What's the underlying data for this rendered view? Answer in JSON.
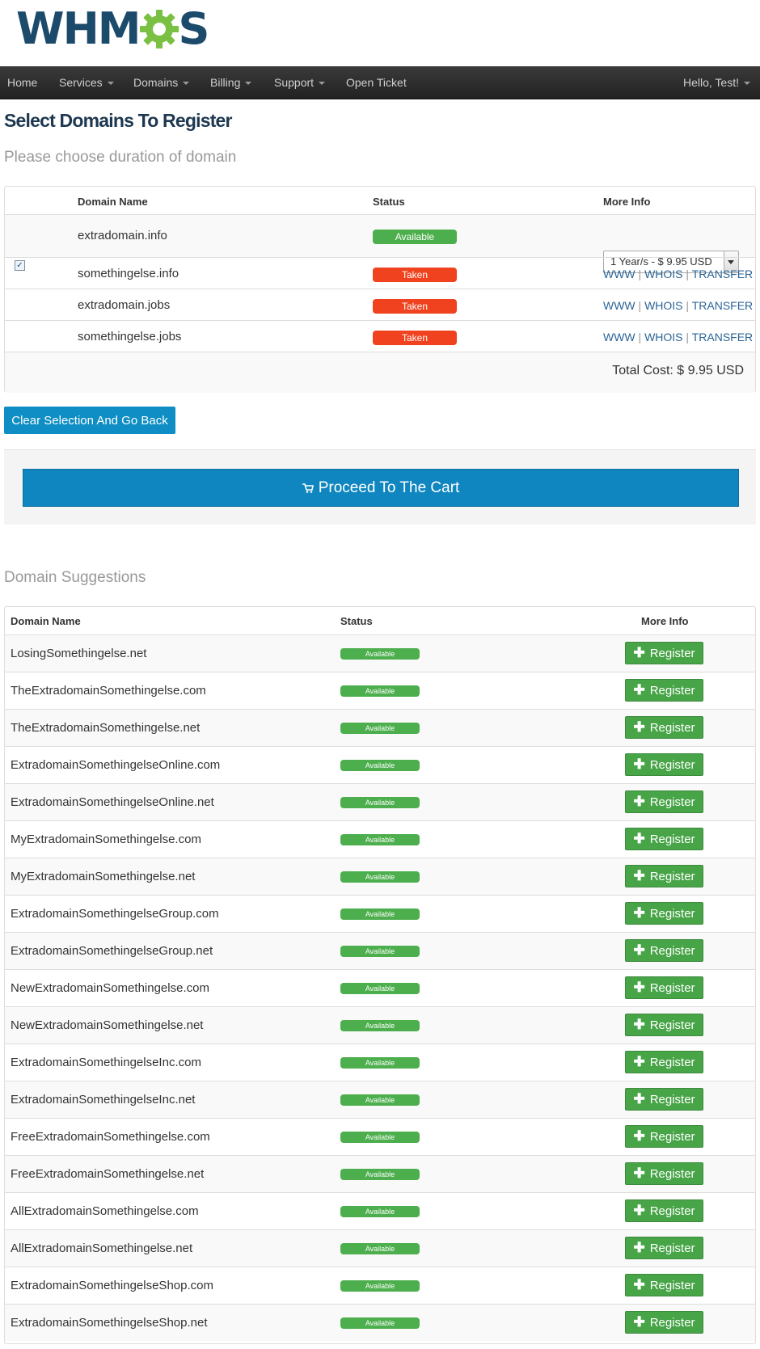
{
  "brand": {
    "logo_text_left": "WHM",
    "logo_text_right": "S",
    "gear_color": "#7ac143",
    "text_color": "#1b4a6b"
  },
  "nav": {
    "home": "Home",
    "services": "Services",
    "domains": "Domains",
    "billing": "Billing",
    "support": "Support",
    "open_ticket": "Open Ticket",
    "user": "Hello, Test!"
  },
  "page": {
    "title": "Select Domains To Register",
    "subtitle": "Please choose duration of domain"
  },
  "selection_table": {
    "headers": {
      "name": "Domain Name",
      "status": "Status",
      "more": "More Info"
    },
    "rows": [
      {
        "domain": "extradomain.info",
        "status": "Available",
        "checked": true,
        "duration": "1 Year/s - $ 9.95 USD"
      },
      {
        "domain": "somethingelse.info",
        "status": "Taken",
        "links": [
          "WWW",
          "WHOIS",
          "TRANSFER"
        ]
      },
      {
        "domain": "extradomain.jobs",
        "status": "Taken",
        "links": [
          "WWW",
          "WHOIS",
          "TRANSFER"
        ]
      },
      {
        "domain": "somethingelse.jobs",
        "status": "Taken",
        "links": [
          "WWW",
          "WHOIS",
          "TRANSFER"
        ]
      }
    ],
    "link_separator": "|",
    "total_label": "Total Cost: $ 9.95 USD"
  },
  "buttons": {
    "clear": "Clear Selection And Go Back",
    "proceed": "Proceed To The Cart"
  },
  "suggestions": {
    "title": "Domain Suggestions",
    "headers": {
      "name": "Domain Name",
      "status": "Status",
      "more": "More Info"
    },
    "status_label": "Available",
    "register_label": "Register",
    "plus_glyph": "✚",
    "domains": [
      "LosingSomethingelse.net",
      "TheExtradomainSomethingelse.com",
      "TheExtradomainSomethingelse.net",
      "ExtradomainSomethingelseOnline.com",
      "ExtradomainSomethingelseOnline.net",
      "MyExtradomainSomethingelse.com",
      "MyExtradomainSomethingelse.net",
      "ExtradomainSomethingelseGroup.com",
      "ExtradomainSomethingelseGroup.net",
      "NewExtradomainSomethingelse.com",
      "NewExtradomainSomethingelse.net",
      "ExtradomainSomethingelseInc.com",
      "ExtradomainSomethingelseInc.net",
      "FreeExtradomainSomethingelse.com",
      "FreeExtradomainSomethingelse.net",
      "AllExtradomainSomethingelse.com",
      "AllExtradomainSomethingelse.net",
      "ExtradomainSomethingelseShop.com",
      "ExtradomainSomethingelseShop.net"
    ]
  },
  "colors": {
    "primary": "#0e8ec4",
    "success": "#47a447",
    "danger": "#f0421e",
    "nav_bg": "#2a2a2a"
  }
}
